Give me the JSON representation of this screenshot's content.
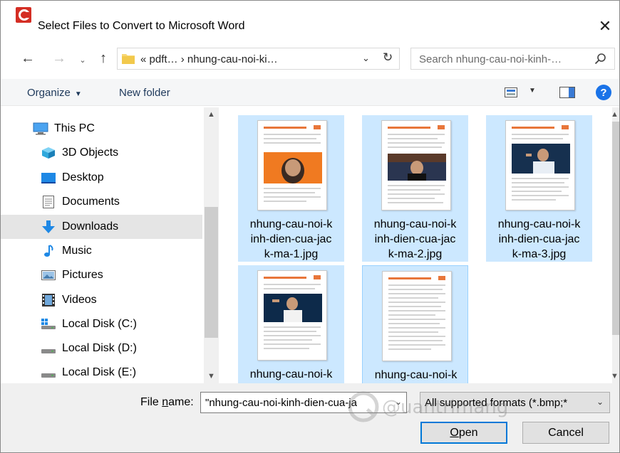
{
  "window": {
    "title": "Select Files to Convert to Microsoft Word",
    "close_glyph": "✕"
  },
  "nav": {
    "back_glyph": "←",
    "forward_glyph": "→",
    "recent_glyph": "⌄",
    "up_glyph": "↑",
    "address_path": "« pdft… › nhung-cau-noi-ki…",
    "address_chevron": "⌄",
    "refresh_glyph": "↻",
    "search_placeholder": "Search nhung-cau-noi-kinh-…"
  },
  "toolbar": {
    "organize_label": "Organize",
    "organize_caret": "▼",
    "new_folder_label": "New folder",
    "view_caret": "▼",
    "help_label": "?"
  },
  "sidebar": {
    "scroll_up": "▲",
    "scroll_down": "▼",
    "items": [
      {
        "label": "This PC",
        "icon": "pc-icon"
      },
      {
        "label": "3D Objects",
        "icon": "cube-icon"
      },
      {
        "label": "Desktop",
        "icon": "desktop-icon"
      },
      {
        "label": "Documents",
        "icon": "document-icon"
      },
      {
        "label": "Downloads",
        "icon": "download-icon",
        "selected": true
      },
      {
        "label": "Music",
        "icon": "music-icon"
      },
      {
        "label": "Pictures",
        "icon": "pictures-icon"
      },
      {
        "label": "Videos",
        "icon": "video-icon"
      },
      {
        "label": "Local Disk (C:)",
        "icon": "system-disk-icon"
      },
      {
        "label": "Local Disk (D:)",
        "icon": "disk-icon"
      },
      {
        "label": "Local Disk (E:)",
        "icon": "disk-icon"
      }
    ]
  },
  "files": {
    "scroll_up": "▲",
    "scroll_down": "▼",
    "items": [
      {
        "label": "nhung-cau-noi-kinh-dien-cua-jack-ma-1.jpg",
        "line1": "nhung-cau-noi-k",
        "line2": "inh-dien-cua-jac",
        "line3": "k-ma-1.jpg"
      },
      {
        "label": "nhung-cau-noi-kinh-dien-cua-jack-ma-2.jpg",
        "line1": "nhung-cau-noi-k",
        "line2": "inh-dien-cua-jac",
        "line3": "k-ma-2.jpg"
      },
      {
        "label": "nhung-cau-noi-kinh-dien-cua-jack-ma-3.jpg",
        "line1": "nhung-cau-noi-k",
        "line2": "inh-dien-cua-jac",
        "line3": "k-ma-3.jpg"
      },
      {
        "label": "nhung-cau-noi-k",
        "line1": "nhung-cau-noi-k"
      },
      {
        "label": "nhung-cau-noi-k",
        "line1": "nhung-cau-noi-k"
      }
    ]
  },
  "bottom": {
    "file_name_label_prefix": "File ",
    "file_name_label_underlined": "n",
    "file_name_label_suffix": "ame:",
    "file_name_value": "\"nhung-cau-noi-kinh-dien-cua-ja",
    "file_name_chevron": "⌄",
    "file_type_value": "All supported formats (*.bmp;*",
    "file_type_chevron": "⌄",
    "open_underlined": "O",
    "open_rest": "pen",
    "cancel_label": "Cancel",
    "watermark": "@uantrimang"
  },
  "colors": {
    "selection": "#cce8ff",
    "selection_border": "#99d1ff",
    "focus_border": "#0078d7",
    "accent_orange": "#e8763a",
    "link_blue": "#1e395b"
  }
}
